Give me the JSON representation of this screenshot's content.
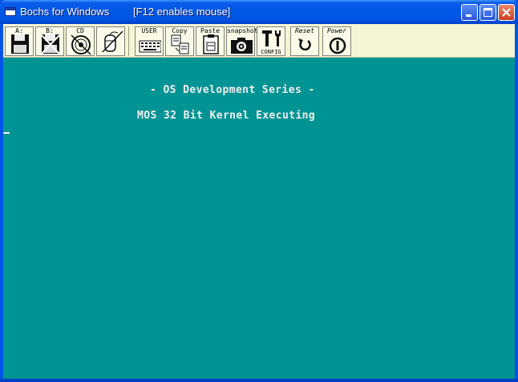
{
  "window": {
    "title": "Bochs for Windows",
    "hint": "[F12 enables mouse]",
    "controls": {
      "minimize": "minimize-icon",
      "maximize": "maximize-icon",
      "close": "close-icon"
    }
  },
  "toolbar": {
    "items": [
      {
        "label": "A:",
        "icon": "floppy-a-icon"
      },
      {
        "label": "B:",
        "icon": "floppy-b-icon"
      },
      {
        "label": "CD",
        "icon": "cdrom-icon"
      },
      {
        "label": "",
        "icon": "mouse-icon"
      },
      {
        "label": "USER",
        "icon": "keyboard-icon"
      },
      {
        "label": "Copy",
        "icon": "copy-icon"
      },
      {
        "label": "Paste",
        "icon": "paste-icon"
      },
      {
        "label": "snapshot",
        "icon": "camera-icon"
      },
      {
        "label": "CONFIG",
        "icon": "config-icon"
      },
      {
        "label": "Reset",
        "icon": "reset-icon"
      },
      {
        "label": "Power",
        "icon": "power-icon"
      }
    ]
  },
  "screen": {
    "background": "#009393",
    "lines": [
      "- OS Development Series -",
      "MOS 32 Bit Kernel Executing"
    ]
  }
}
